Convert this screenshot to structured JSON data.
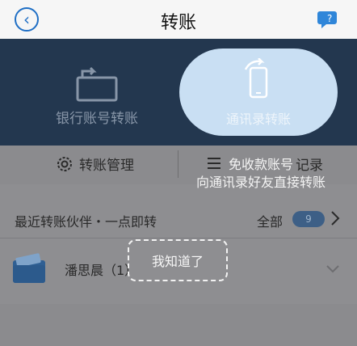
{
  "header": {
    "title": "转账",
    "back_icon": "back-icon",
    "help_icon": "help-chat-icon"
  },
  "transfer_options": {
    "bank": {
      "label": "银行账号转账",
      "icon": "bank-card-transfer-icon"
    },
    "contacts": {
      "label": "通讯录转账",
      "icon": "phone-transfer-icon"
    }
  },
  "menu": {
    "manage_label": "转账管理",
    "record_label": "记录",
    "gear_icon": "gear-icon",
    "record_icon": "list-icon"
  },
  "tooltip": {
    "line1": "免收款账号",
    "line2": "向通讯录好友直接转账",
    "dismiss_label": "我知道了"
  },
  "recent": {
    "label": "最近转账伙伴・一点即转",
    "all_label": "全部",
    "count": "9"
  },
  "contacts": [
    {
      "name": "潘思晨（1）",
      "icon": "wallet-icon"
    }
  ],
  "colors": {
    "accent": "#1f6fc5",
    "banner": "#23374f",
    "highlight": "#c9dff3",
    "overlay": "#8e8e91"
  }
}
